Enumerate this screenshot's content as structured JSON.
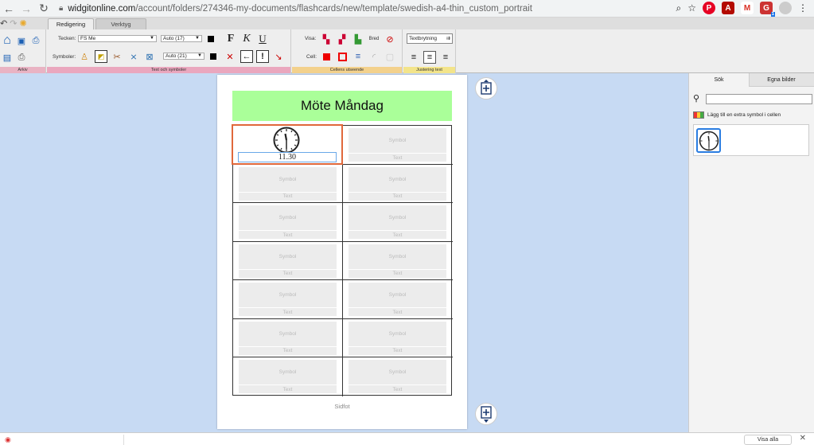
{
  "browser": {
    "url_host": "widgitonline.com",
    "url_path": "/account/folders/274346-my-documents/flashcards/new/template/swedish-a4-thin_custom_portrait",
    "ext_badge": "1",
    "ext_m": "M"
  },
  "ribbon": {
    "tabs": [
      "Redigering",
      "Verktyg"
    ],
    "arkiv_label": "Arkiv",
    "text_symbols": {
      "label": "Text och symboler",
      "tecken_label": "Tecken:",
      "font_value": "FS Me",
      "text_size": "Auto (17)",
      "symboler_label": "Symboler:",
      "symbol_size": "Auto (21)",
      "bold": "F",
      "italic": "K",
      "underline": "U"
    },
    "cell_look": {
      "label": "Cellens utseende",
      "visa_label": "Visa:",
      "cell_label": "Cell:"
    },
    "justify": {
      "label": "Justering text",
      "wrap_label": "Textbrytning"
    }
  },
  "page": {
    "title": "Möte Måndag",
    "symbol_placeholder": "Symbol",
    "text_placeholder": "Text",
    "selected_text": "11.30",
    "footer": "Sidfot"
  },
  "panel": {
    "tab_search": "Sök",
    "tab_own": "Egna bilder",
    "search_value": "",
    "extra_symbol": "Lägg till en extra symbol i cellen"
  },
  "downloads": {
    "show_all": "Visa alla"
  },
  "colors": {
    "title_bg": "#aaff99",
    "selection": "#e0683b",
    "workspace": "#c7daf3"
  }
}
